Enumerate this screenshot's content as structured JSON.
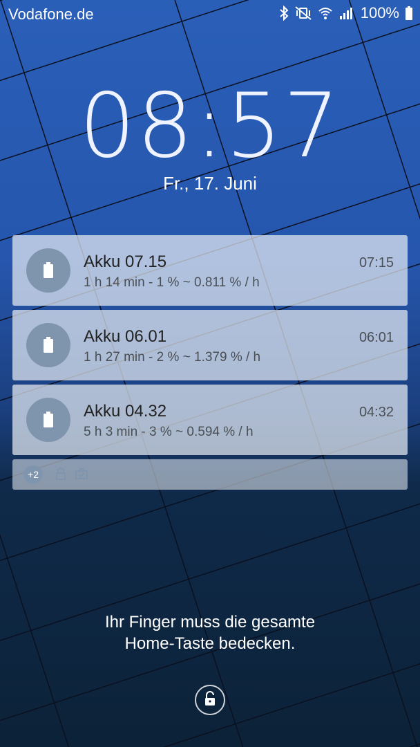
{
  "status_bar": {
    "carrier": "Vodafone.de",
    "battery_percent": "100%",
    "icons": [
      "bluetooth-icon",
      "mute-vibrate-icon",
      "wifi-icon",
      "signal-icon",
      "battery-icon"
    ]
  },
  "clock": {
    "time": "08:57",
    "date": "Fr., 17. Juni"
  },
  "notifications": [
    {
      "title": "Akku 07.15",
      "detail": "1 h 14 min - 1 % ~ 0.811 % / h",
      "time": "07:15",
      "icon": "battery-icon"
    },
    {
      "title": "Akku 06.01",
      "detail": "1 h 27 min - 2 % ~ 1.379 % / h",
      "time": "06:01",
      "icon": "battery-icon"
    },
    {
      "title": "Akku 04.32",
      "detail": "5 h 3 min - 3 % ~ 0.594 % / h",
      "time": "04:32",
      "icon": "battery-icon"
    }
  ],
  "more": {
    "badge": "+2",
    "icons": [
      "lock-icon",
      "briefcase-icon"
    ]
  },
  "hint": {
    "line1": "Ihr Finger muss die gesamte",
    "line2": "Home-Taste bedecken."
  },
  "colors": {
    "wallpaper_top": "#2a5fb8",
    "wallpaper_bottom": "#0c2238",
    "notification_icon_bg": "#7f95ad"
  }
}
